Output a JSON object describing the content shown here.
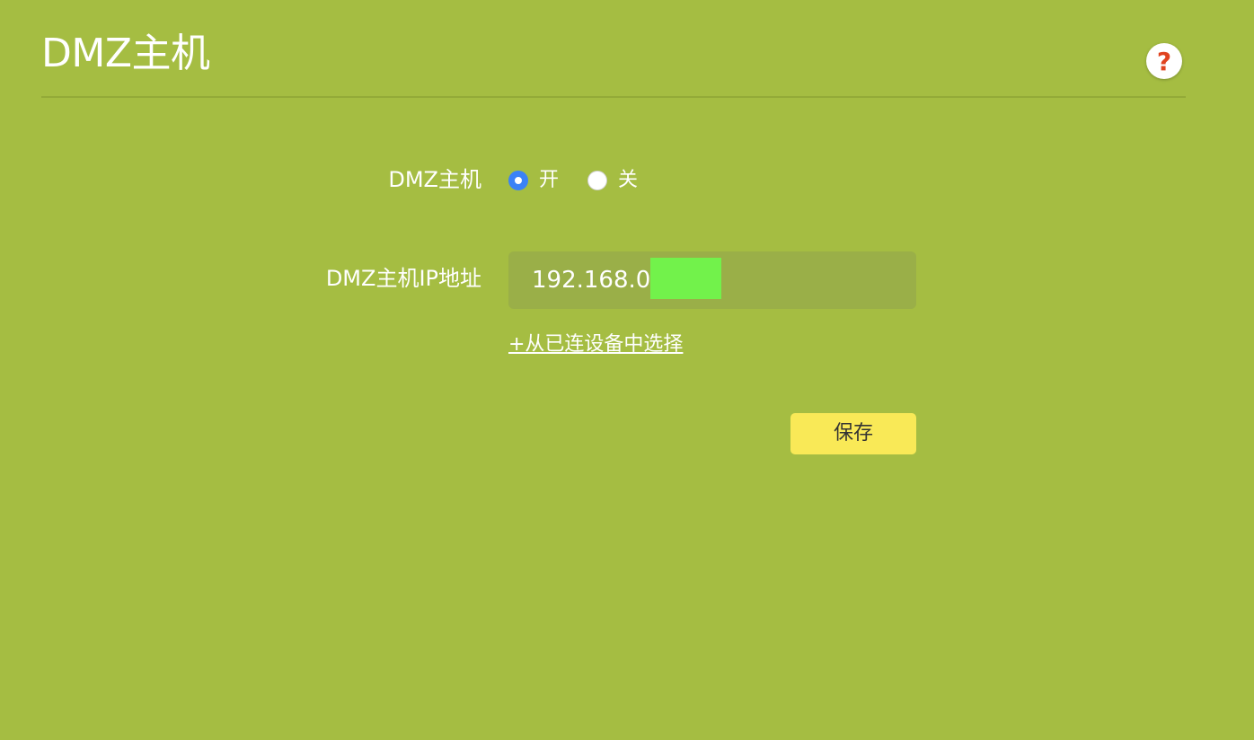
{
  "page": {
    "title": "DMZ主机"
  },
  "form": {
    "dmz_label": "DMZ主机",
    "radio_on_label": "开",
    "radio_off_label": "关",
    "selected": "on",
    "ip_label": "DMZ主机IP地址",
    "ip_value": "192.168.0.1",
    "select_link_label": "+从已连设备中选择",
    "save_label": "保存"
  },
  "icons": {
    "help": "help-question-icon"
  },
  "colors": {
    "background": "#a5bd42",
    "divider": "#93aa38",
    "field_background": "#9aaf48",
    "radio_checked": "#3b82f6",
    "save_button": "#f9e957",
    "help_question_mark": "#e0431f",
    "redaction": "#72f24b"
  }
}
